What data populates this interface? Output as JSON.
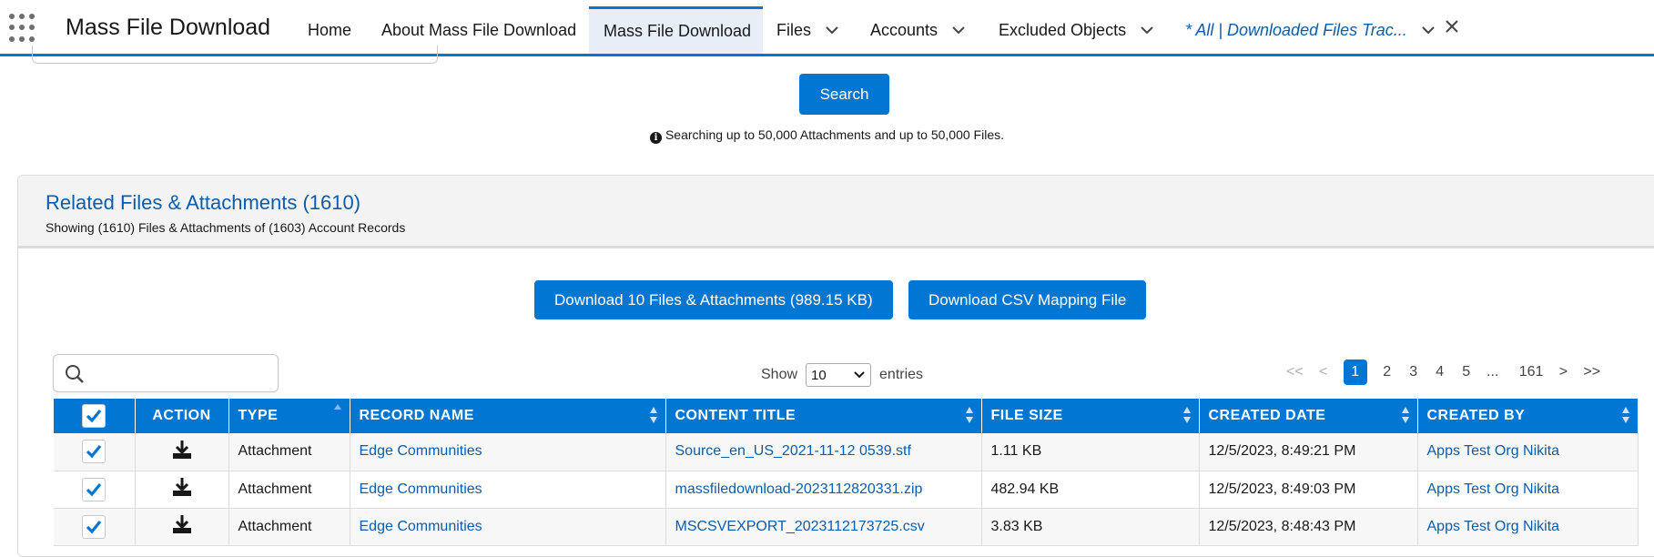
{
  "nav": {
    "app_name": "Mass File Download",
    "items": [
      {
        "label": "Home"
      },
      {
        "label": "About Mass File Download"
      },
      {
        "label": "Mass File Download"
      },
      {
        "label": "Files"
      },
      {
        "label": "Accounts"
      },
      {
        "label": "Excluded Objects"
      },
      {
        "label": "* All | Downloaded Files Trac..."
      }
    ]
  },
  "search": {
    "button_label": "Search",
    "info_text": "Searching up to 50,000 Attachments and up to 50,000 Files."
  },
  "card": {
    "title": "Related Files & Attachments (1610)",
    "subtitle": "Showing (1610) Files & Attachments of (1603) Account Records",
    "download_button": "Download 10 Files & Attachments (989.15 KB)",
    "csv_button": "Download CSV Mapping File"
  },
  "controls": {
    "show_label": "Show",
    "entries_value": "10",
    "entries_label": "entries"
  },
  "pagination": {
    "first": "<<",
    "prev": "<",
    "pages": [
      "1",
      "2",
      "3",
      "4",
      "5"
    ],
    "ellipsis": "...",
    "last_page": "161",
    "next": ">",
    "last": ">>"
  },
  "table": {
    "headers": {
      "action": "ACTION",
      "type": "TYPE",
      "record_name": "RECORD NAME",
      "content_title": "CONTENT TITLE",
      "file_size": "FILE SIZE",
      "created_date": "CREATED DATE",
      "created_by": "CREATED BY"
    },
    "rows": [
      {
        "type": "Attachment",
        "record_name": "Edge Communities",
        "content_title": "Source_en_US_2021-11-12 0539.stf",
        "file_size": "1.11 KB",
        "created_date": "12/5/2023, 8:49:21 PM",
        "created_by": "Apps Test Org Nikita"
      },
      {
        "type": "Attachment",
        "record_name": "Edge Communities",
        "content_title": "massfiledownload-2023112820331.zip",
        "file_size": "482.94 KB",
        "created_date": "12/5/2023, 8:49:03 PM",
        "created_by": "Apps Test Org Nikita"
      },
      {
        "type": "Attachment",
        "record_name": "Edge Communities",
        "content_title": "MSCSVEXPORT_2023112173725.csv",
        "file_size": "3.83 KB",
        "created_date": "12/5/2023, 8:48:43 PM",
        "created_by": "Apps Test Org Nikita"
      }
    ]
  },
  "colors": {
    "brand": "#0176d3",
    "link": "#0b5cab"
  }
}
